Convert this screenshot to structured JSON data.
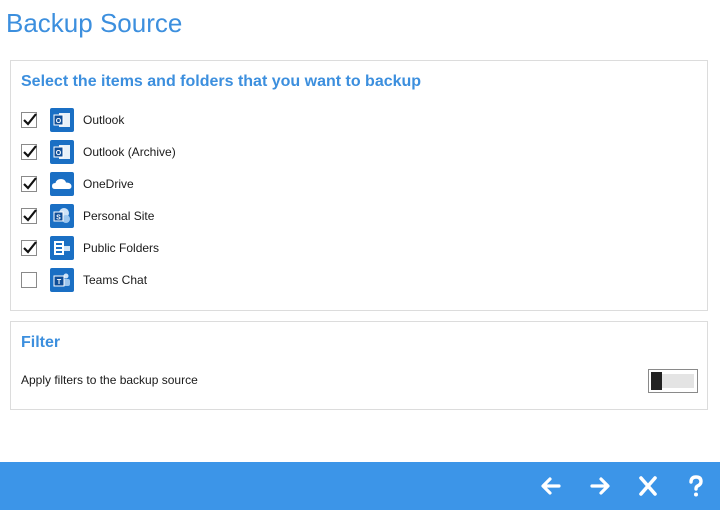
{
  "title": "Backup Source",
  "items_section": {
    "heading": "Select the items and folders that you want to backup",
    "items": [
      {
        "label": "Outlook",
        "checked": true,
        "icon": "outlook-icon"
      },
      {
        "label": "Outlook (Archive)",
        "checked": true,
        "icon": "outlook-archive-icon"
      },
      {
        "label": "OneDrive",
        "checked": true,
        "icon": "onedrive-icon"
      },
      {
        "label": "Personal Site",
        "checked": true,
        "icon": "sharepoint-icon"
      },
      {
        "label": "Public Folders",
        "checked": true,
        "icon": "exchange-icon"
      },
      {
        "label": "Teams Chat",
        "checked": false,
        "icon": "teams-icon"
      }
    ]
  },
  "filter_section": {
    "heading": "Filter",
    "label": "Apply filters to the backup source",
    "enabled": false
  },
  "navigation": {
    "buttons": [
      "back-arrow-icon",
      "next-arrow-icon",
      "close-icon",
      "help-icon"
    ]
  },
  "colors": {
    "accent": "#3c8fde",
    "bottom_bar": "#3c95e8"
  }
}
